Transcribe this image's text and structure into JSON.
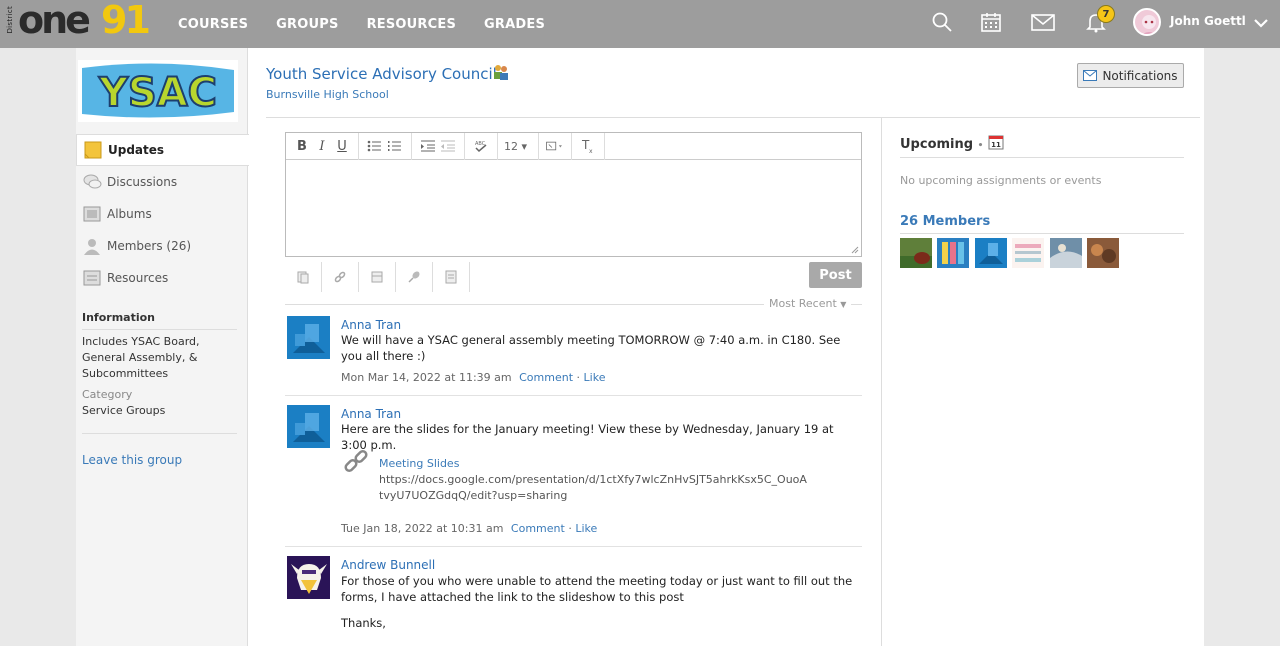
{
  "topbar": {
    "logo_district": "District",
    "logo_one": "one",
    "logo_num": "91",
    "nav": [
      "COURSES",
      "GROUPS",
      "RESOURCES",
      "GRADES"
    ],
    "notification_count": "7",
    "user_name": "John Goettl"
  },
  "group": {
    "logo_text": "YSAC",
    "title": "Youth Service Advisory Council",
    "school": "Burnsville High School",
    "notifications_button": "Notifications"
  },
  "sidebar": {
    "items": [
      {
        "label": "Updates",
        "icon": "updates-icon",
        "active": true
      },
      {
        "label": "Discussions",
        "icon": "discussions-icon"
      },
      {
        "label": "Albums",
        "icon": "albums-icon"
      },
      {
        "label": "Members (26)",
        "icon": "members-icon"
      },
      {
        "label": "Resources",
        "icon": "resources-icon"
      }
    ],
    "information_heading": "Information",
    "description": "Includes YSAC Board, General Assembly, & Subcommittees",
    "category_label": "Category",
    "category_value": "Service Groups",
    "leave_link": "Leave this group"
  },
  "editor": {
    "bold": "B",
    "italic": "I",
    "underline": "U",
    "font_size": "12",
    "post_button": "Post",
    "sort_label": "Most Recent"
  },
  "posts": [
    {
      "author": "Anna Tran",
      "text": "We will have a YSAC general assembly meeting TOMORROW @ 7:40 a.m. in C180. See you all there :)",
      "date": "Mon Mar 14, 2022 at 11:39 am",
      "comment": "Comment",
      "like": "Like"
    },
    {
      "author": "Anna Tran",
      "text": "Here are the slides for the January meeting! View these by Wednesday, January 19 at 3:00 p.m.",
      "link_title": "Meeting Slides",
      "link_url_line1": "https://docs.google.com/presentation/d/1ctXfy7wlcZnHvSJT5ahrkKsx5C_OuoA",
      "link_url_line2": "tvyU7UOZGdqQ/edit?usp=sharing",
      "date": "Tue Jan 18, 2022 at 10:31 am",
      "comment": "Comment",
      "like": "Like"
    },
    {
      "author": "Andrew Bunnell",
      "text": "For those of you who were unable to attend the meeting today or just want to fill out the forms, I have attached the link to the slideshow to this post",
      "text2": "Thanks,"
    }
  ],
  "right": {
    "upcoming_heading": "Upcoming",
    "no_upcoming": "No upcoming assignments or events",
    "members_heading": "26 Members"
  },
  "colors": {
    "topbar": "#9d9d9d",
    "link": "#3a7ab8",
    "logo_yellow": "#f2c80f"
  }
}
